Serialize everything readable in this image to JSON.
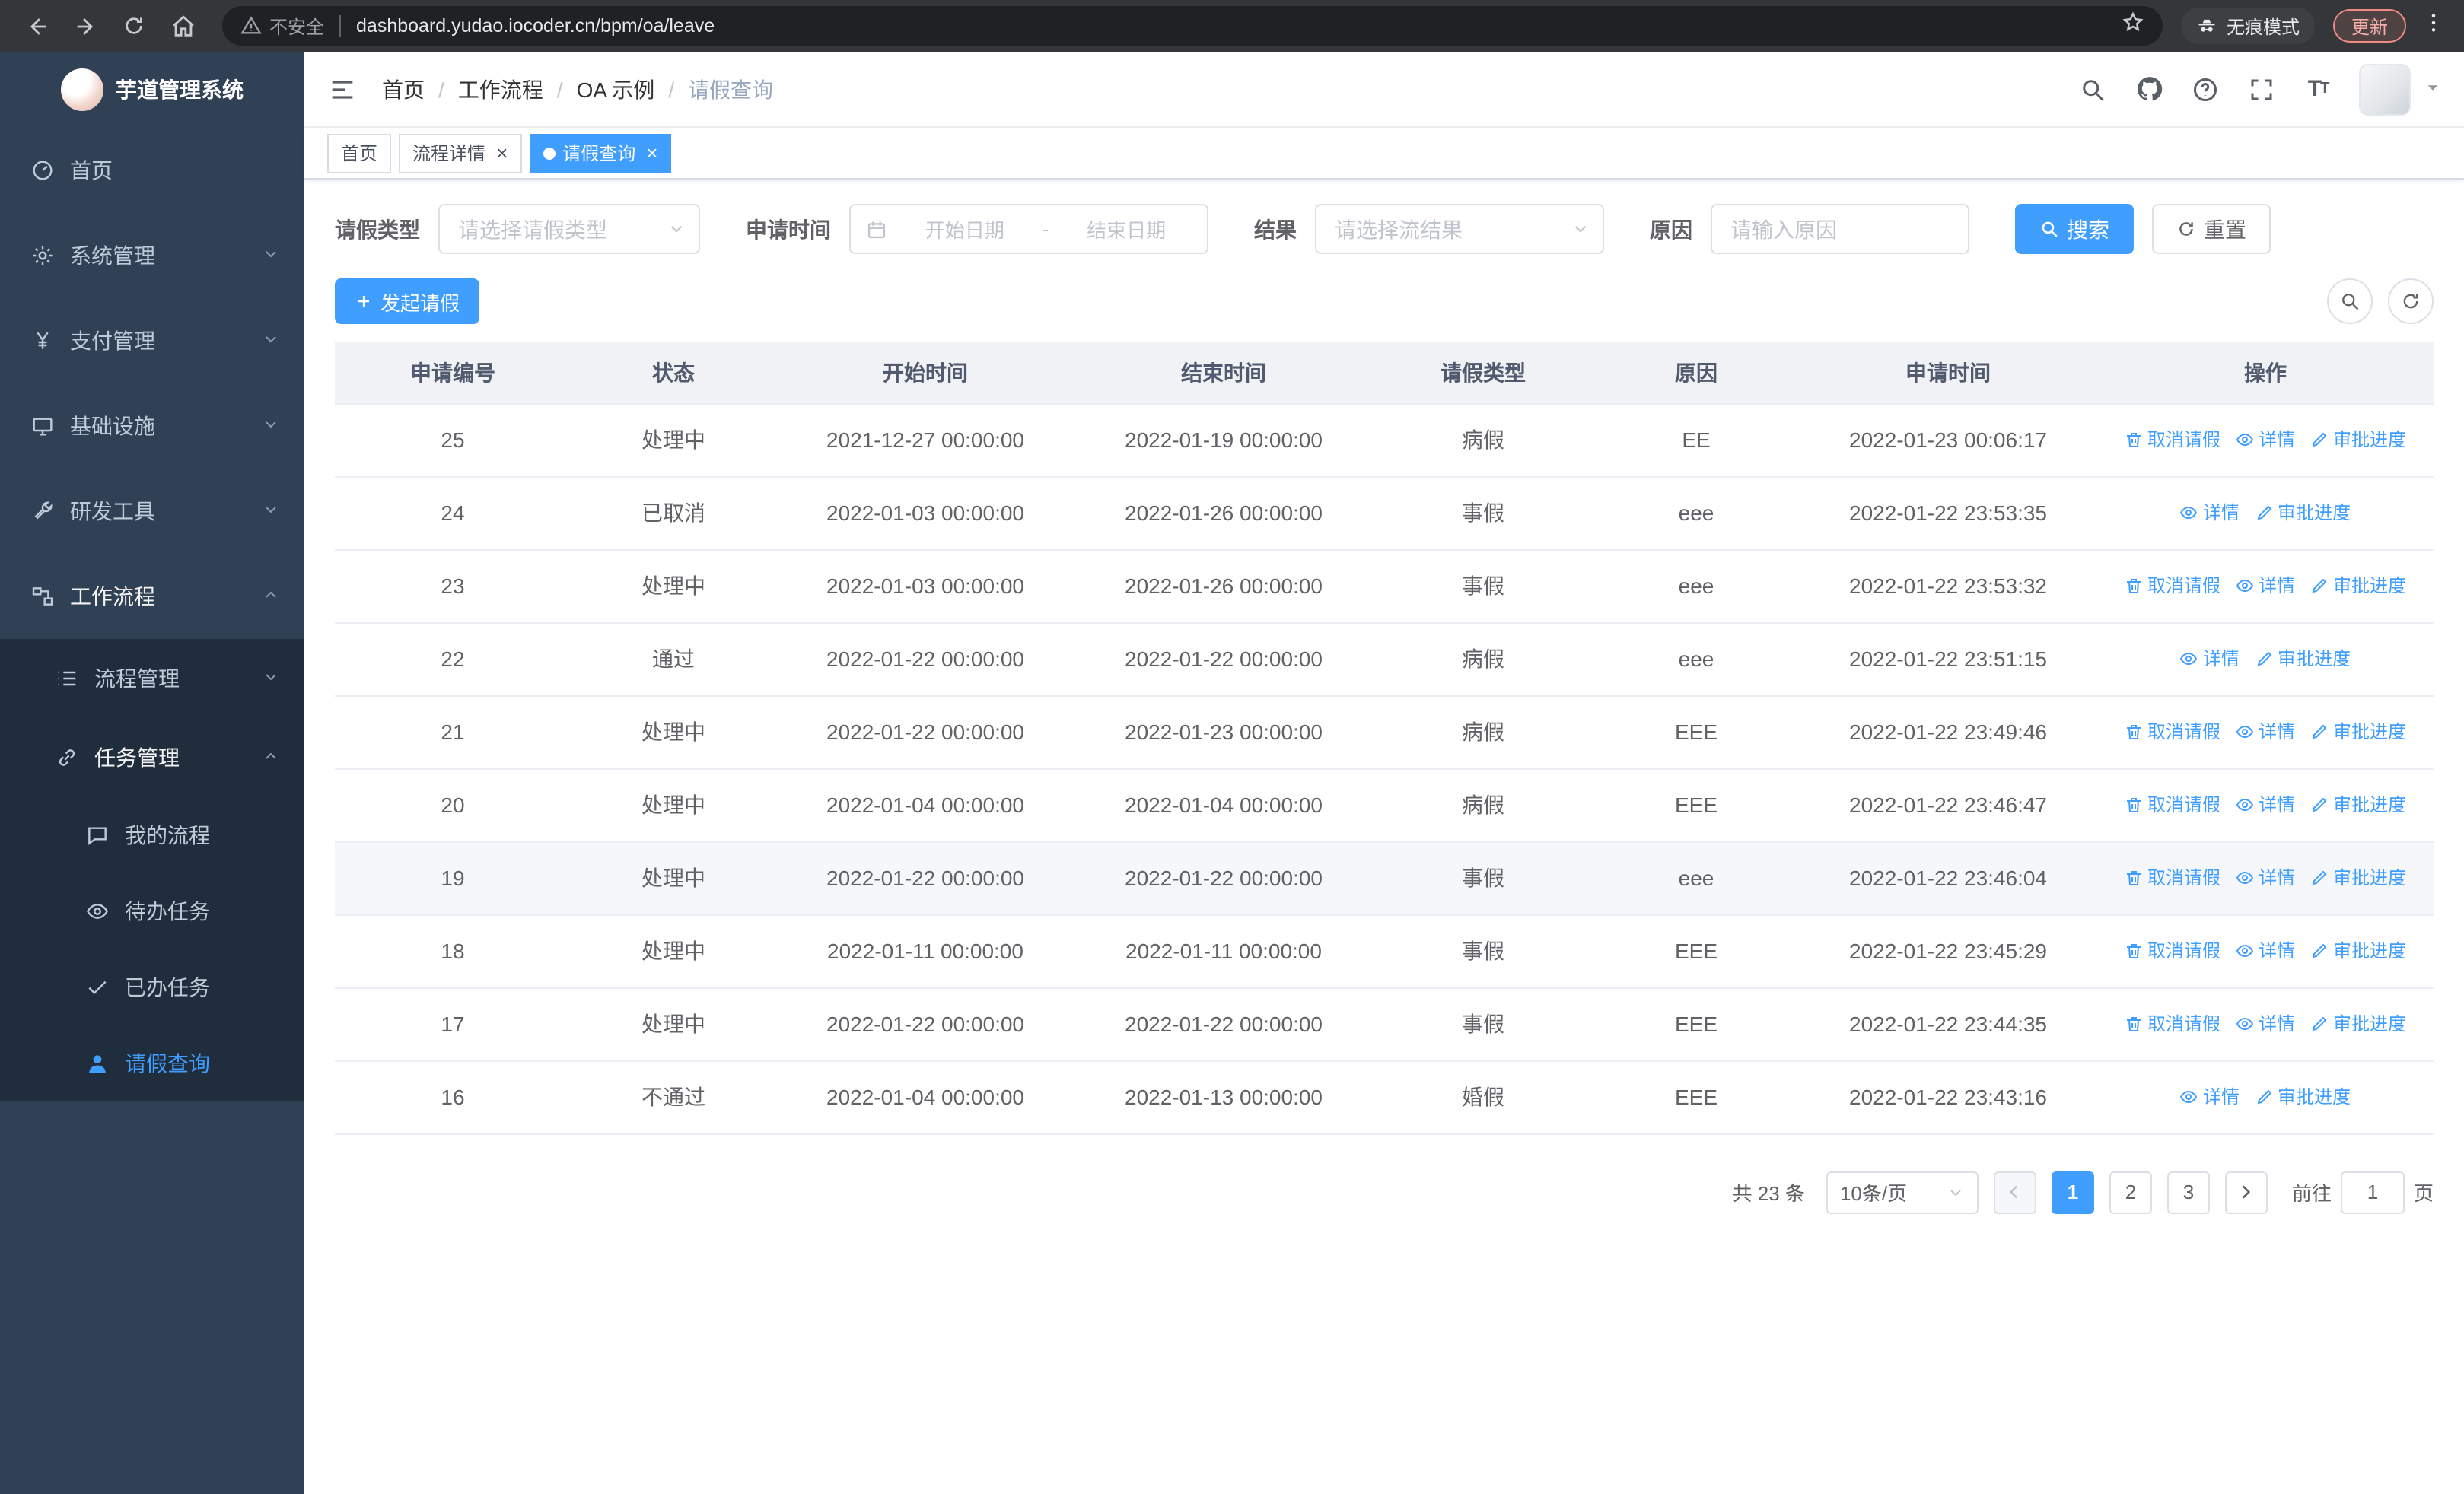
{
  "browser": {
    "security_warning": "不安全",
    "url": "dashboard.yudao.iocoder.cn/bpm/oa/leave",
    "incognito_label": "无痕模式",
    "update_label": "更新"
  },
  "sidebar": {
    "logo_title": "芋道管理系统",
    "items": [
      {
        "label": "首页",
        "icon": "dashboard-icon",
        "level": 1
      },
      {
        "label": "系统管理",
        "icon": "gear-icon",
        "level": 1,
        "expanded": false
      },
      {
        "label": "支付管理",
        "icon": "yen-icon",
        "level": 1,
        "expanded": false
      },
      {
        "label": "基础设施",
        "icon": "infrastructure-icon",
        "level": 1,
        "expanded": false
      },
      {
        "label": "研发工具",
        "icon": "tools-icon",
        "level": 1,
        "expanded": false
      },
      {
        "label": "工作流程",
        "icon": "workflow-icon",
        "level": 1,
        "expanded": true
      },
      {
        "label": "流程管理",
        "icon": "process-icon",
        "level": 2,
        "expanded": false
      },
      {
        "label": "任务管理",
        "icon": "task-icon",
        "level": 2,
        "expanded": true
      },
      {
        "label": "我的流程",
        "icon": "my-process-icon",
        "level": 3
      },
      {
        "label": "待办任务",
        "icon": "todo-task-icon",
        "level": 3
      },
      {
        "label": "已办任务",
        "icon": "done-task-icon",
        "level": 3
      },
      {
        "label": "请假查询",
        "icon": "leave-query-icon",
        "level": 3,
        "active": true
      }
    ]
  },
  "header": {
    "breadcrumb": [
      "首页",
      "工作流程",
      "OA 示例",
      "请假查询"
    ]
  },
  "tabs": [
    {
      "label": "首页",
      "closable": false,
      "active": false
    },
    {
      "label": "流程详情",
      "closable": true,
      "active": false
    },
    {
      "label": "请假查询",
      "closable": true,
      "active": true
    }
  ],
  "filters": {
    "leave_type_label": "请假类型",
    "leave_type_placeholder": "请选择请假类型",
    "apply_time_label": "申请时间",
    "start_date_placeholder": "开始日期",
    "date_separator": "-",
    "end_date_placeholder": "结束日期",
    "result_label": "结果",
    "result_placeholder": "请选择流结果",
    "reason_label": "原因",
    "reason_placeholder": "请输入原因",
    "search_button": "搜索",
    "reset_button": "重置"
  },
  "toolbar": {
    "create_button": "发起请假"
  },
  "table": {
    "columns": [
      "申请编号",
      "状态",
      "开始时间",
      "结束时间",
      "请假类型",
      "原因",
      "申请时间",
      "操作"
    ],
    "action_labels": {
      "cancel": "取消请假",
      "detail": "详情",
      "progress": "审批进度"
    },
    "rows": [
      {
        "id": "25",
        "status": "处理中",
        "start": "2021-12-27 00:00:00",
        "end": "2022-01-19 00:00:00",
        "type": "病假",
        "reason": "EE",
        "applied": "2022-01-23 00:06:17",
        "actions": [
          "cancel",
          "detail",
          "progress"
        ],
        "highlighted": false
      },
      {
        "id": "24",
        "status": "已取消",
        "start": "2022-01-03 00:00:00",
        "end": "2022-01-26 00:00:00",
        "type": "事假",
        "reason": "eee",
        "applied": "2022-01-22 23:53:35",
        "actions": [
          "detail",
          "progress"
        ],
        "highlighted": false
      },
      {
        "id": "23",
        "status": "处理中",
        "start": "2022-01-03 00:00:00",
        "end": "2022-01-26 00:00:00",
        "type": "事假",
        "reason": "eee",
        "applied": "2022-01-22 23:53:32",
        "actions": [
          "cancel",
          "detail",
          "progress"
        ],
        "highlighted": false
      },
      {
        "id": "22",
        "status": "通过",
        "start": "2022-01-22 00:00:00",
        "end": "2022-01-22 00:00:00",
        "type": "病假",
        "reason": "eee",
        "applied": "2022-01-22 23:51:15",
        "actions": [
          "detail",
          "progress"
        ],
        "highlighted": false
      },
      {
        "id": "21",
        "status": "处理中",
        "start": "2022-01-22 00:00:00",
        "end": "2022-01-23 00:00:00",
        "type": "病假",
        "reason": "EEE",
        "applied": "2022-01-22 23:49:46",
        "actions": [
          "cancel",
          "detail",
          "progress"
        ],
        "highlighted": false
      },
      {
        "id": "20",
        "status": "处理中",
        "start": "2022-01-04 00:00:00",
        "end": "2022-01-04 00:00:00",
        "type": "病假",
        "reason": "EEE",
        "applied": "2022-01-22 23:46:47",
        "actions": [
          "cancel",
          "detail",
          "progress"
        ],
        "highlighted": false
      },
      {
        "id": "19",
        "status": "处理中",
        "start": "2022-01-22 00:00:00",
        "end": "2022-01-22 00:00:00",
        "type": "事假",
        "reason": "eee",
        "applied": "2022-01-22 23:46:04",
        "actions": [
          "cancel",
          "detail",
          "progress"
        ],
        "highlighted": true
      },
      {
        "id": "18",
        "status": "处理中",
        "start": "2022-01-11 00:00:00",
        "end": "2022-01-11 00:00:00",
        "type": "事假",
        "reason": "EEE",
        "applied": "2022-01-22 23:45:29",
        "actions": [
          "cancel",
          "detail",
          "progress"
        ],
        "highlighted": false
      },
      {
        "id": "17",
        "status": "处理中",
        "start": "2022-01-22 00:00:00",
        "end": "2022-01-22 00:00:00",
        "type": "事假",
        "reason": "EEE",
        "applied": "2022-01-22 23:44:35",
        "actions": [
          "cancel",
          "detail",
          "progress"
        ],
        "highlighted": false
      },
      {
        "id": "16",
        "status": "不通过",
        "start": "2022-01-04 00:00:00",
        "end": "2022-01-13 00:00:00",
        "type": "婚假",
        "reason": "EEE",
        "applied": "2022-01-22 23:43:16",
        "actions": [
          "detail",
          "progress"
        ],
        "highlighted": false
      }
    ]
  },
  "pagination": {
    "total_text": "共 23 条",
    "page_size": "10条/页",
    "pages": [
      "1",
      "2",
      "3"
    ],
    "active_page": "1",
    "goto_label": "前往",
    "goto_value": "1",
    "goto_suffix": "页"
  },
  "colors": {
    "primary": "#409eff",
    "sidebar_bg": "#304156",
    "submenu_bg": "#1f2d3d",
    "active_tab_bg": "#409eff",
    "update_badge": "#f28b82",
    "table_header_bg": "#f0f2f5"
  }
}
